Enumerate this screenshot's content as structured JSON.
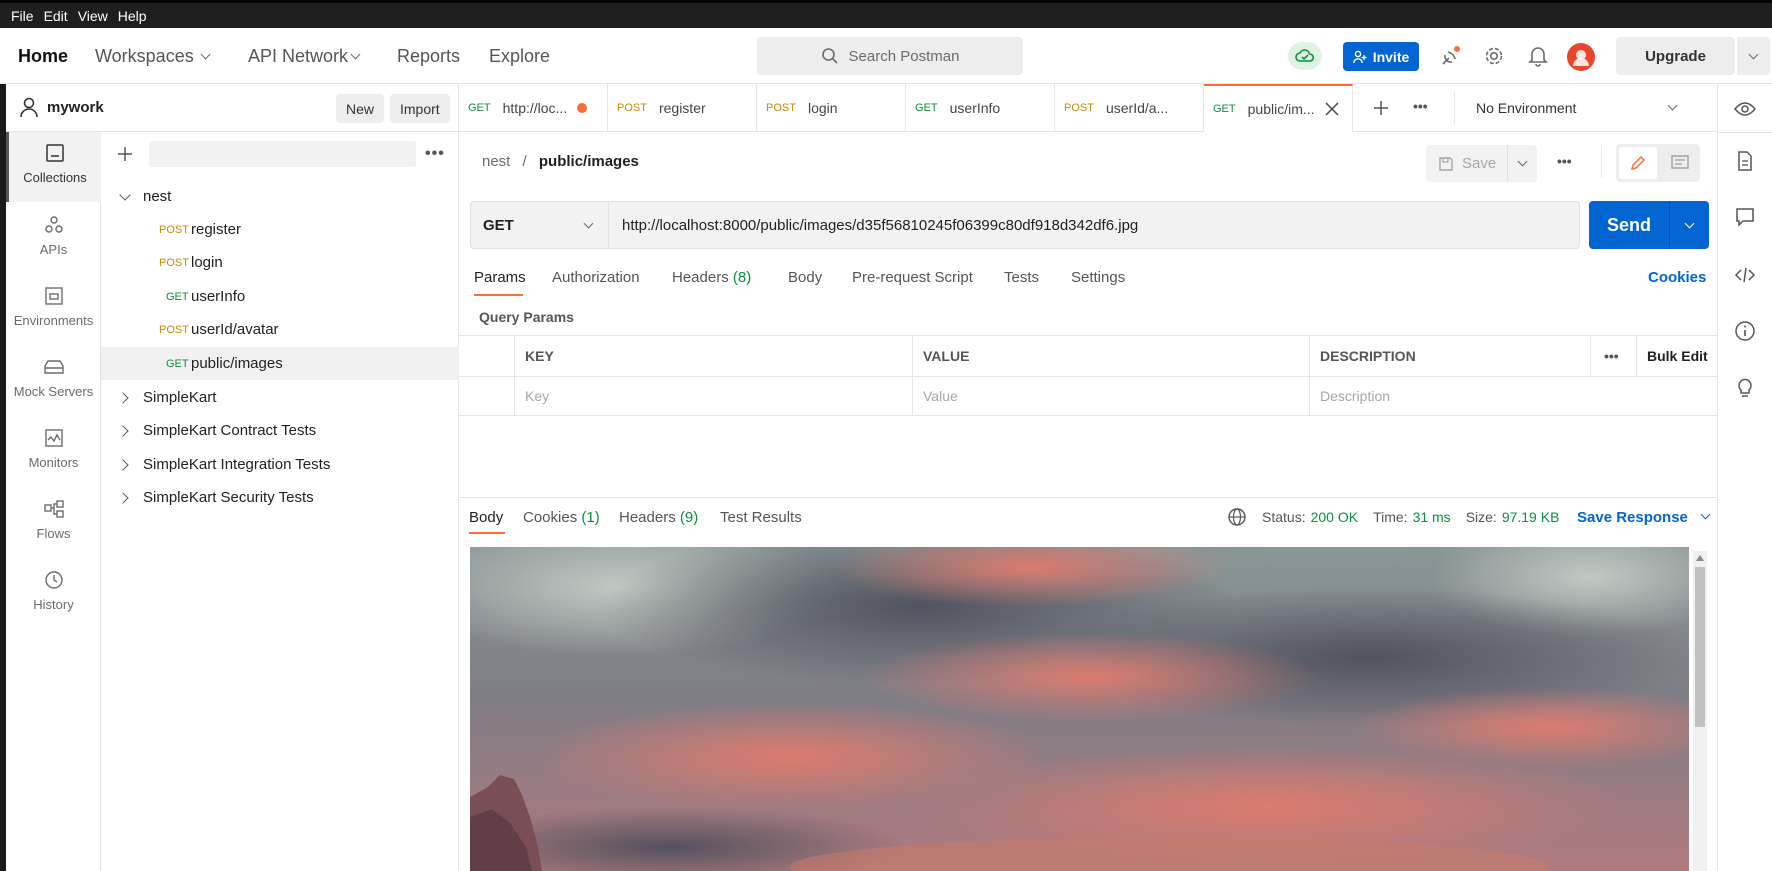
{
  "menubar": [
    "File",
    "Edit",
    "View",
    "Help"
  ],
  "header": {
    "nav": [
      "Home",
      "Workspaces",
      "API Network",
      "Reports",
      "Explore"
    ],
    "search_placeholder": "Search Postman",
    "invite_label": "Invite",
    "upgrade_label": "Upgrade"
  },
  "workspace": {
    "name": "mywork",
    "new_label": "New",
    "import_label": "Import"
  },
  "sidebar": {
    "items": [
      {
        "label": "Collections",
        "icon": "collections-icon"
      },
      {
        "label": "APIs",
        "icon": "apis-icon"
      },
      {
        "label": "Environments",
        "icon": "environments-icon"
      },
      {
        "label": "Mock Servers",
        "icon": "mock-servers-icon"
      },
      {
        "label": "Monitors",
        "icon": "monitors-icon"
      },
      {
        "label": "Flows",
        "icon": "flows-icon"
      },
      {
        "label": "History",
        "icon": "history-icon"
      }
    ]
  },
  "tree": {
    "root": "nest",
    "requests": [
      {
        "method": "POST",
        "name": "register"
      },
      {
        "method": "POST",
        "name": "login"
      },
      {
        "method": "GET",
        "name": "userInfo"
      },
      {
        "method": "POST",
        "name": "userId/avatar"
      },
      {
        "method": "GET",
        "name": "public/images"
      }
    ],
    "collections": [
      "SimpleKart",
      "SimpleKart Contract Tests",
      "SimpleKart Integration Tests",
      "SimpleKart Security Tests"
    ]
  },
  "tabs": [
    {
      "method": "GET",
      "name": "http://loc..."
    },
    {
      "method": "POST",
      "name": "register"
    },
    {
      "method": "POST",
      "name": "login"
    },
    {
      "method": "GET",
      "name": "userInfo"
    },
    {
      "method": "POST",
      "name": "userId/a..."
    },
    {
      "method": "GET",
      "name": "public/im..."
    }
  ],
  "environment": "No Environment",
  "request": {
    "breadcrumb_parent": "nest",
    "breadcrumb_sep": "/",
    "breadcrumb_current": "public/images",
    "save_label": "Save",
    "method": "GET",
    "url": "http://localhost:8000/public/images/d35f56810245f06399c80df918d342df6.jpg",
    "send_label": "Send",
    "tabs": {
      "params": "Params",
      "authorization": "Authorization",
      "headers": "Headers",
      "headers_count": "(8)",
      "body": "Body",
      "prerequest": "Pre-request Script",
      "tests": "Tests",
      "settings": "Settings"
    },
    "cookies_link": "Cookies",
    "query_params_label": "Query Params",
    "table": {
      "headers": [
        "KEY",
        "VALUE",
        "DESCRIPTION"
      ],
      "placeholders": [
        "Key",
        "Value",
        "Description"
      ],
      "bulk_edit": "Bulk Edit"
    }
  },
  "response": {
    "tabs": {
      "body": "Body",
      "cookies": "Cookies",
      "cookies_count": "(1)",
      "headers": "Headers",
      "headers_count": "(9)",
      "test_results": "Test Results"
    },
    "status_label": "Status:",
    "status_value": "200 OK",
    "time_label": "Time:",
    "time_value": "31 ms",
    "size_label": "Size:",
    "size_value": "97.19 KB",
    "save_response": "Save Response"
  },
  "colors": {
    "accent": "#ff6c37",
    "primary": "#0265d2",
    "get": "#0a8f3d",
    "post": "#c88a00"
  }
}
